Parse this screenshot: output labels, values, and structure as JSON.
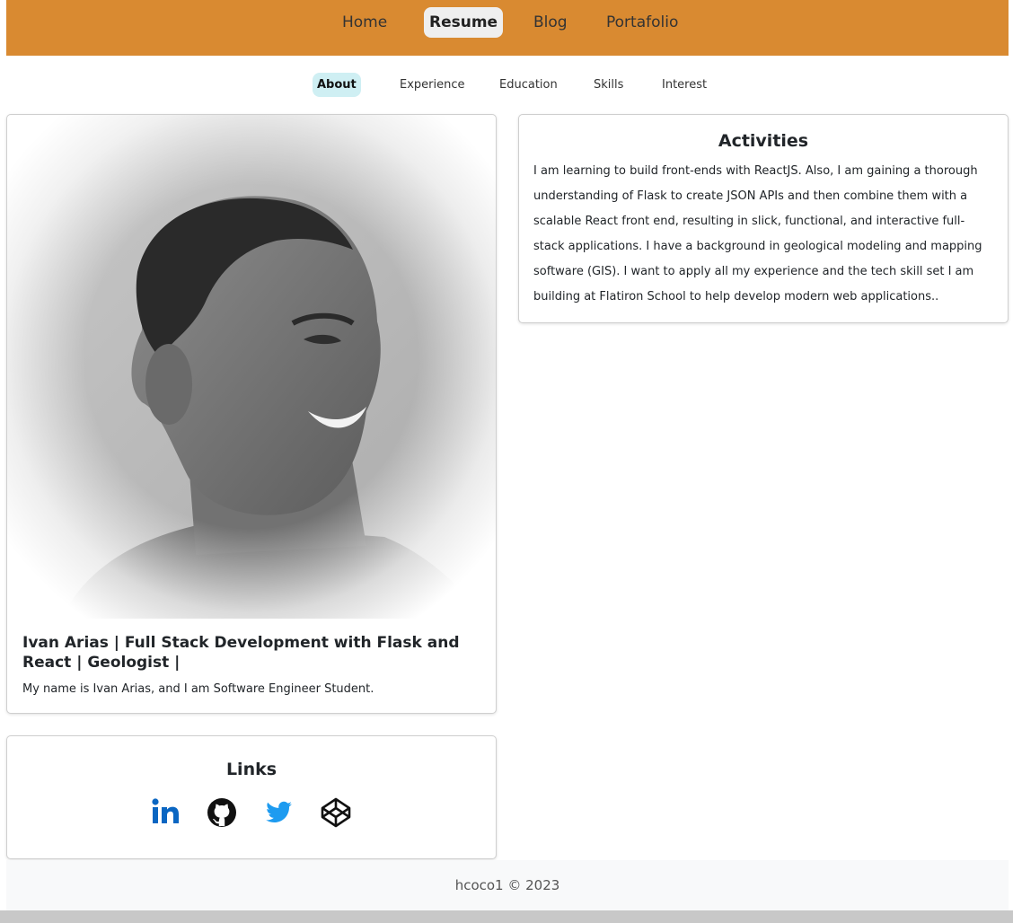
{
  "topnav": {
    "items": [
      {
        "label": "Home"
      },
      {
        "label": "Resume"
      },
      {
        "label": "Blog"
      },
      {
        "label": "Portafolio"
      }
    ],
    "active": "Resume"
  },
  "subnav": {
    "tabs": [
      {
        "label": "About"
      },
      {
        "label": "Experience"
      },
      {
        "label": "Education"
      },
      {
        "label": "Skills"
      },
      {
        "label": "Interest"
      }
    ],
    "active": "About"
  },
  "profile": {
    "title": "Ivan Arias | Full Stack Development with Flask and React | Geologist |",
    "text": "My name is Ivan Arias, and I am Software Engineer Student."
  },
  "activities": {
    "title": "Activities",
    "text": "I am learning to build front-ends with ReactJS. Also, I am gaining a thorough understanding of Flask to create JSON APIs and then combine them with a scalable React front end, resulting in slick, functional, and interactive full-stack applications. I have a background in geological modeling and mapping software (GIS). I want to apply all my experience and the tech skill set I am building at Flatiron School to help develop modern web applications.."
  },
  "links": {
    "title": "Links",
    "icons": [
      "linkedin-icon",
      "github-icon",
      "twitter-icon",
      "codepen-icon"
    ]
  },
  "footer": {
    "text": "hcoco1 © 2023"
  },
  "colors": {
    "navbar": "#d98a31",
    "active_tab": "#cfeff3",
    "linkedin": "#0a66c2",
    "twitter": "#1d9bf0"
  }
}
